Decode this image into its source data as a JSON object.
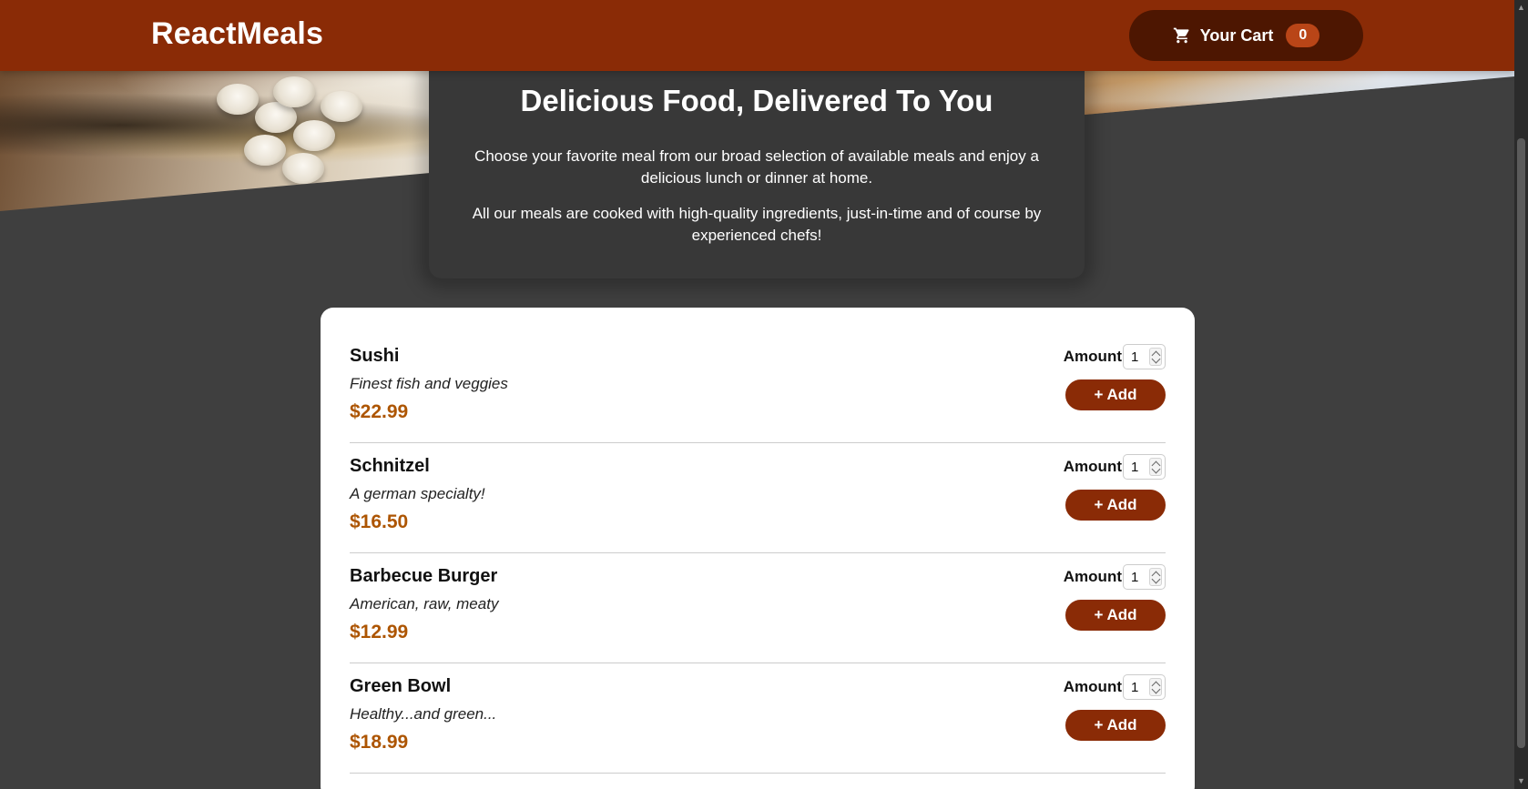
{
  "header": {
    "brand": "ReactMeals",
    "cart_label": "Your Cart",
    "cart_count": "0"
  },
  "summary": {
    "title": "Delicious Food, Delivered To You",
    "paragraphs": [
      "Choose your favorite meal from our broad selection of available meals and enjoy a delicious lunch or dinner at home.",
      "All our meals are cooked with high-quality ingredients, just-in-time and of course by experienced chefs!"
    ]
  },
  "meals": [
    {
      "name": "Sushi",
      "description": "Finest fish and veggies",
      "price": "$22.99",
      "amount_label": "Amount",
      "amount_value": "1",
      "add_label": "+ Add"
    },
    {
      "name": "Schnitzel",
      "description": "A german specialty!",
      "price": "$16.50",
      "amount_label": "Amount",
      "amount_value": "1",
      "add_label": "+ Add"
    },
    {
      "name": "Barbecue Burger",
      "description": "American, raw, meaty",
      "price": "$12.99",
      "amount_label": "Amount",
      "amount_value": "1",
      "add_label": "+ Add"
    },
    {
      "name": "Green Bowl",
      "description": "Healthy...and green...",
      "price": "$18.99",
      "amount_label": "Amount",
      "amount_value": "1",
      "add_label": "+ Add"
    }
  ],
  "icons": {
    "cart": "cart-icon",
    "hero": "hero-food-image"
  },
  "colors": {
    "header": "#8a2b06",
    "cart_button": "#4d1601",
    "badge": "#b94517",
    "price": "#ad5502",
    "background": "#3f3f3f",
    "summary_card": "#383838"
  }
}
